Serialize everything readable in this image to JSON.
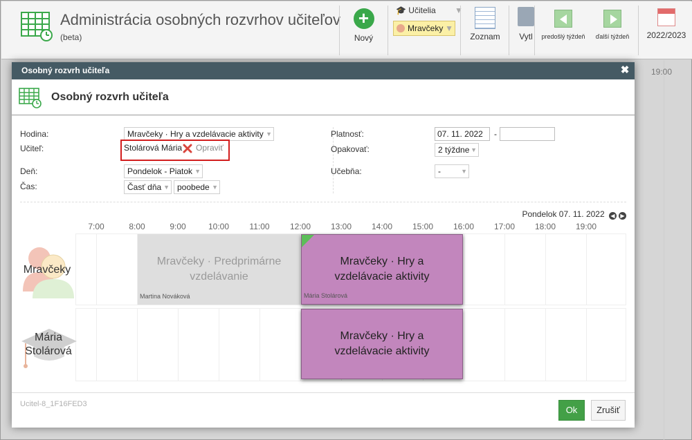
{
  "app": {
    "title": "Administrácia osobných rozvrhov učiteľov",
    "subtitle": "(beta)"
  },
  "toolbar": {
    "new_label": "Nový",
    "role_label": "Učitelia",
    "class_label": "Mravčeky",
    "list_label": "Zoznam",
    "print_label": "Vytl",
    "prev_week_label": "predošlý týždeň",
    "next_week_label": "ďalší týždeň",
    "year_label": "2022/2023"
  },
  "background": {
    "hour_label": "19:00"
  },
  "modal": {
    "window_title": "Osobný rozvrh učiteľa",
    "header_title": "Osobný rozvrh učiteľa",
    "form": {
      "lesson_label": "Hodina:",
      "lesson_value": "Mravčeky · Hry a vzdelávacie aktivity",
      "teacher_label": "Učiteľ:",
      "teacher_value": "Stolárová Mária",
      "fix_label": "Opraviť",
      "day_label": "Deň:",
      "day_value": "Pondelok - Piatok",
      "time_label": "Čas:",
      "time_part_value": "Časť dňa",
      "time_period_value": "poobede",
      "validity_label": "Platnosť:",
      "validity_from": "07. 11. 2022",
      "validity_to": "",
      "repeat_label": "Opakovať:",
      "repeat_value": "2 týždne",
      "room_label": "Učebňa:",
      "room_value": "-"
    },
    "schedule": {
      "date_label": "Pondelok 07. 11. 2022",
      "hours": [
        "7:00",
        "8:00",
        "9:00",
        "10:00",
        "11:00",
        "12:00",
        "13:00",
        "14:00",
        "15:00",
        "16:00",
        "17:00",
        "18:00",
        "19:00"
      ],
      "rows": [
        {
          "label": "Mravčeky",
          "icon": "class-children-icon"
        },
        {
          "label": "Mária Stolárová",
          "icon": "teacher-graduation-cap-icon"
        }
      ],
      "events": [
        {
          "title": "Mravčeky · Predprimárne vzdelávanie",
          "owner": "Martina Nováková"
        },
        {
          "title": "Mravčeky · Hry a vzdelávacie aktivity",
          "owner": "Mária Stolárová"
        },
        {
          "title": "Mravčeky · Hry a vzdelávacie aktivity",
          "owner": ""
        }
      ]
    },
    "footer": {
      "id_label": "Ucitel-8_1F16FED3",
      "ok_label": "Ok",
      "cancel_label": "Zrušiť"
    }
  },
  "colors": {
    "titlebar": "#455a64",
    "event_purple": "#c286bd",
    "event_grey": "#dedede",
    "ok_green": "#43a047",
    "highlight_red": "#d21d1d"
  }
}
